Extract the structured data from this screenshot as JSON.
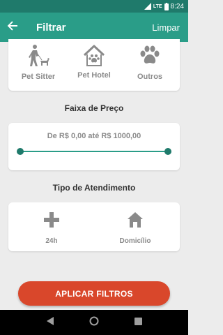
{
  "status": {
    "network": "LTE",
    "time": "8:24"
  },
  "appbar": {
    "title": "Filtrar",
    "clear_label": "Limpar"
  },
  "services": [
    {
      "label": "Pet Sitter",
      "icon": "person-walking-dog-icon"
    },
    {
      "label": "Pet Hotel",
      "icon": "pet-house-icon"
    },
    {
      "label": "Outros",
      "icon": "paw-icon"
    }
  ],
  "price": {
    "section_title": "Faixa de Preço",
    "range_text": "De R$ 0,00 até R$ 1000,00",
    "min": 0,
    "max": 1000,
    "selected_min": 0,
    "selected_max": 1000
  },
  "service_type": {
    "section_title": "Tipo de Atendimento",
    "options": [
      {
        "label": "24h",
        "icon": "plus-icon"
      },
      {
        "label": "Domicílio",
        "icon": "home-icon"
      }
    ]
  },
  "apply_button": {
    "label": "APLICAR FILTROS"
  },
  "colors": {
    "primary": "#2a9d88",
    "primary_dark": "#1f7a6b",
    "accent": "#d9472b",
    "muted": "#8a8a8a"
  }
}
